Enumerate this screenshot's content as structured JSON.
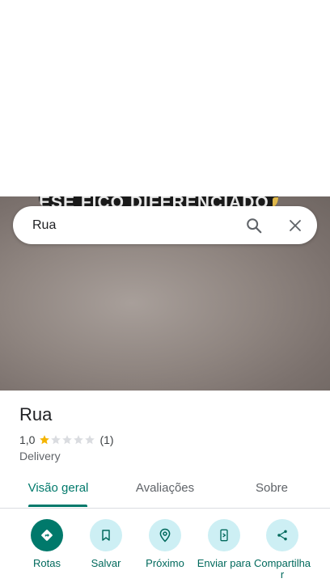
{
  "hero": {
    "banner_text": "ESE FICO DIFERENCIADO"
  },
  "search": {
    "value": "Rua"
  },
  "place": {
    "name": "Rua",
    "rating": "1,0",
    "rating_value": 1,
    "rating_max": 5,
    "review_count": "(1)",
    "category": "Delivery"
  },
  "tabs": [
    {
      "label": "Visão geral",
      "active": true
    },
    {
      "label": "Avaliações",
      "active": false
    },
    {
      "label": "Sobre",
      "active": false
    }
  ],
  "actions": [
    {
      "label": "Rotas",
      "icon": "directions-icon"
    },
    {
      "label": "Salvar",
      "icon": "bookmark-icon"
    },
    {
      "label": "Próximo",
      "icon": "nearby-icon"
    },
    {
      "label": "Enviar para o",
      "icon": "send-to-phone-icon"
    },
    {
      "label": "Compartilhar",
      "icon": "share-icon"
    }
  ],
  "colors": {
    "accent": "#00796b",
    "action_bg": "#cdeff4",
    "star_filled": "#f4b400",
    "star_empty": "#dadce0"
  }
}
